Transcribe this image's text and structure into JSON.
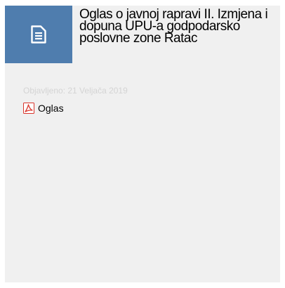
{
  "article": {
    "title": "Oglas o javnoj rapravi II. Izmjena i dopuna UPU-a godpodarsko poslovne zone Ratac",
    "published": "Objavljeno: 21 Veljača 2019",
    "header_icon": "document-icon"
  },
  "attachments": [
    {
      "label": "Oglas",
      "icon": "pdf-icon"
    }
  ],
  "colors": {
    "card_background": "#f0f0f0",
    "icon_box": "#4f7dae",
    "meta_text": "#d4d4d4",
    "pdf_red": "#d9342b"
  }
}
